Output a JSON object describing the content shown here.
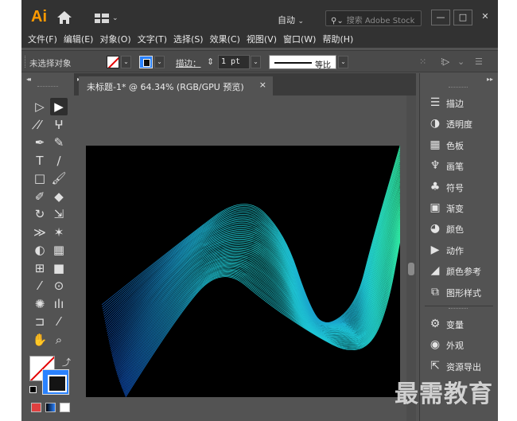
{
  "app": {
    "logo": "Ai",
    "workspace": "自动",
    "search_placeholder": "搜索 Adobe Stock",
    "window_controls": [
      "—",
      "□",
      "✕"
    ]
  },
  "menu": [
    "文件(F)",
    "编辑(E)",
    "对象(O)",
    "文字(T)",
    "选择(S)",
    "效果(C)",
    "视图(V)",
    "窗口(W)",
    "帮助(H)"
  ],
  "control_bar": {
    "selection_status": "未选择对象",
    "stroke_label": "描边：",
    "stroke_value": "1 pt",
    "profile_label": "等比"
  },
  "document": {
    "tab_title": "未标题-1* @ 64.34% (RGB/GPU 预览)",
    "close_glyph": "×"
  },
  "tools": [
    "selection-tool",
    "direct-selection-tool",
    "magic-wand-tool",
    "lasso-tool",
    "pen-tool",
    "curvature-tool",
    "type-tool",
    "line-segment-tool",
    "rectangle-tool",
    "paintbrush-tool",
    "shaper-tool",
    "eraser-tool",
    "rotate-tool",
    "scale-tool",
    "width-tool",
    "puppet-warp-tool",
    "shape-builder-tool",
    "perspective-grid-tool",
    "mesh-tool",
    "gradient-tool",
    "eyedropper-tool",
    "blend-tool",
    "symbol-sprayer-tool",
    "column-graph-tool",
    "artboard-tool",
    "slice-tool",
    "hand-tool",
    "zoom-tool"
  ],
  "panels": [
    {
      "label": "描边",
      "icon": "stroke-icon"
    },
    {
      "label": "透明度",
      "icon": "transparency-icon"
    },
    {
      "label": "色板",
      "icon": "swatches-icon"
    },
    {
      "label": "画笔",
      "icon": "brushes-icon"
    },
    {
      "label": "符号",
      "icon": "symbols-icon"
    },
    {
      "label": "渐变",
      "icon": "gradient-icon"
    },
    {
      "label": "颜色",
      "icon": "color-icon"
    },
    {
      "label": "动作",
      "icon": "actions-icon"
    },
    {
      "label": "颜色参考",
      "icon": "color-guide-icon"
    },
    {
      "label": "图形样式",
      "icon": "graphic-styles-icon"
    },
    {
      "label": "变量",
      "icon": "variables-icon"
    },
    {
      "label": "外观",
      "icon": "appearance-icon"
    },
    {
      "label": "资源导出",
      "icon": "asset-export-icon"
    }
  ],
  "artwork": {
    "background": "#000000",
    "gradient_colors": [
      "#0f4fb8",
      "#1ec8d6",
      "#2ee6a0"
    ]
  },
  "watermark": "最需教育"
}
